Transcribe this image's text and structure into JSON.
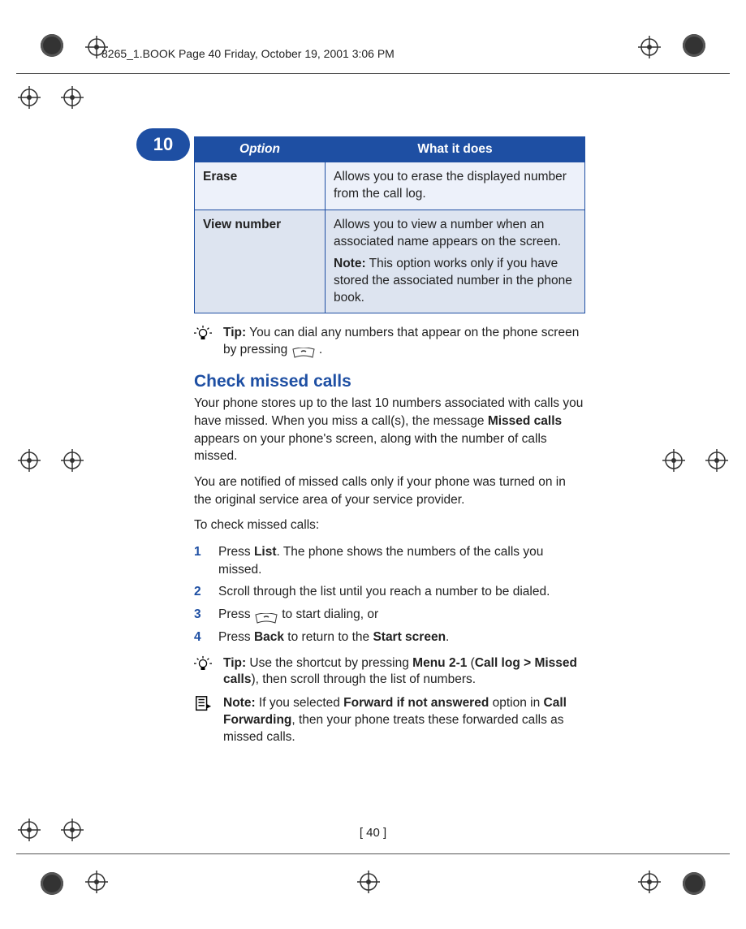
{
  "header": {
    "running": "8265_1.BOOK  Page 40  Friday, October 19, 2001  3:06 PM"
  },
  "chapter": {
    "number": "10"
  },
  "table": {
    "head": {
      "option": "Option",
      "what": "What it does"
    },
    "rows": [
      {
        "label": "Erase",
        "desc": "Allows you to erase the displayed number from the call log."
      },
      {
        "label": "View number",
        "desc": "Allows you to view a number when an associated name appears on the screen.",
        "note_label": "Note:",
        "note": "  This option works only if you have stored the associated number in the phone book."
      }
    ]
  },
  "tip1": {
    "label": "Tip:",
    "text": "  You can dial any numbers that appear on the phone screen by pressing",
    "after": " ."
  },
  "section": {
    "title": "Check missed calls"
  },
  "body": {
    "p1a": "Your phone stores up to the last 10 numbers associated with calls you have missed. When you miss a call(s), the message ",
    "p1b": "Missed calls",
    "p1c": " appears on your phone's screen, along with the number of calls missed.",
    "p2": "You are notified of missed calls only if your phone was turned on in the original service area of your service provider.",
    "p3": "To check missed calls:"
  },
  "steps": [
    {
      "n": "1",
      "pre": "Press ",
      "b1": "List",
      "post": ". The phone shows the numbers of the calls you missed."
    },
    {
      "n": "2",
      "pre": "Scroll through the list until you reach a number to be dialed.",
      "b1": "",
      "post": ""
    },
    {
      "n": "3",
      "pre": "Press ",
      "key": true,
      "post": "to start dialing, or"
    },
    {
      "n": "4",
      "pre": "Press ",
      "b1": "Back",
      "mid": " to return to the ",
      "b2": "Start screen",
      "post": "."
    }
  ],
  "tip2": {
    "label": "Tip:",
    "t1": " Use the shortcut by pressing ",
    "b1": "Menu 2-1",
    "t2": " (",
    "b2": "Call log > Missed calls",
    "t3": "), then scroll through the list of numbers."
  },
  "note2": {
    "label": "Note:",
    "t1": " If you selected ",
    "b1": "Forward if not answered",
    "t2": " option in ",
    "b2": "Call Forwarding",
    "t3": ", then your phone treats these forwarded calls as missed calls."
  },
  "footer": {
    "pagenum": "[ 40 ]"
  }
}
